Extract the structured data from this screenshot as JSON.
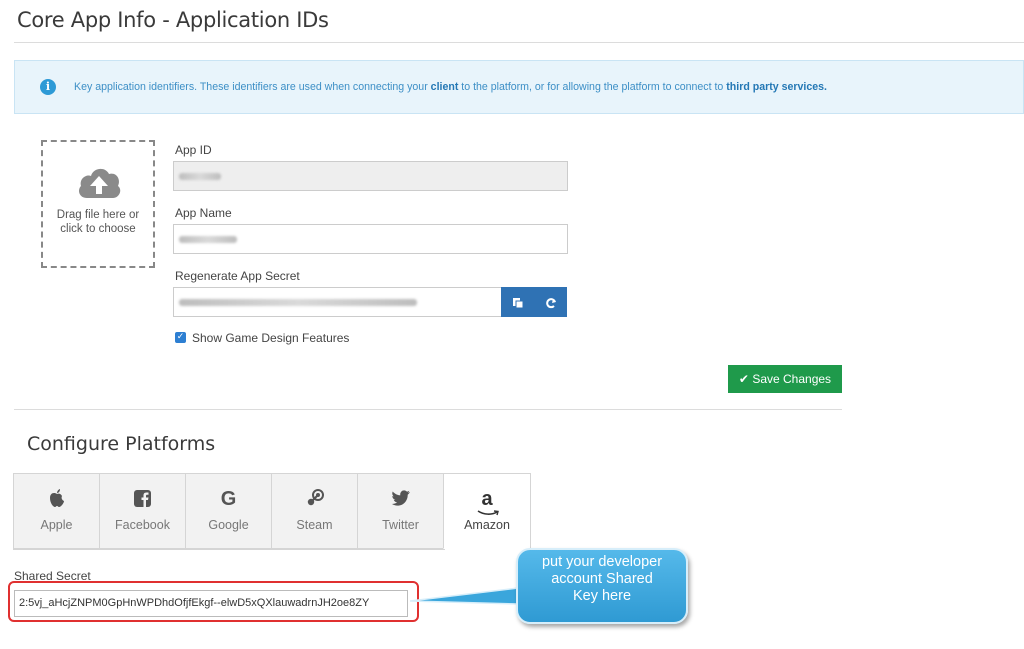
{
  "page": {
    "title": "Core App Info - Application IDs"
  },
  "info": {
    "text_before": "Key application identifiers. These identifiers are used when connecting your ",
    "bold1": "client",
    "text_middle": " to the platform, or for allowing the platform to connect to ",
    "bold2": "third party services."
  },
  "dropzone": {
    "line1": "Drag file here or",
    "line2": "click to choose",
    "icon": "cloud-upload-icon"
  },
  "form": {
    "app_id_label": "App ID",
    "app_name_label": "App Name",
    "secret_label": "Regenerate App Secret",
    "copy_icon": "copy-icon",
    "refresh_icon": "refresh-icon",
    "show_game_label": "Show Game Design Features",
    "show_game_checked": true,
    "save_label": "Save Changes"
  },
  "platforms": {
    "title": "Configure Platforms",
    "tabs": [
      {
        "label": "Apple",
        "icon": "apple-icon"
      },
      {
        "label": "Facebook",
        "icon": "facebook-icon"
      },
      {
        "label": "Google",
        "icon": "google-icon"
      },
      {
        "label": "Steam",
        "icon": "steam-icon"
      },
      {
        "label": "Twitter",
        "icon": "twitter-icon"
      },
      {
        "label": "Amazon",
        "icon": "amazon-icon"
      }
    ],
    "active_tab": "Amazon",
    "shared_secret_label": "Shared Secret",
    "shared_secret_value": "2:5vj_aHcjZNPM0GpHnWPDhdOfjfEkgf--elwD5xQXlauwadrnJH2oe8ZY"
  },
  "callout": {
    "line1": "put your developer",
    "line2": "account Shared",
    "line3": "Key here"
  },
  "colors": {
    "info_bg": "#e8f4fb",
    "info_text": "#3d8fc6",
    "primary_button": "#2f72b4",
    "save_button": "#1f9a4b",
    "highlight_outline": "#e03030",
    "callout_bg": "#3aa6dc"
  }
}
